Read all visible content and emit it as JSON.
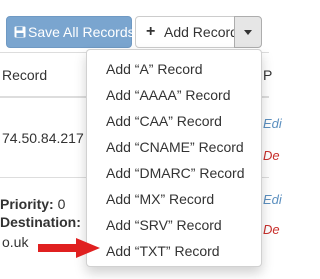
{
  "toolbar": {
    "save_all_label": "Save All Records",
    "add_record_label": "Add Record",
    "save_icon": "floppy-disk-icon",
    "add_icon": "plus-icon",
    "caret_icon": "caret-down-icon"
  },
  "table": {
    "header": {
      "record": "Record",
      "partial_col": "P"
    },
    "row1": {
      "ip": "74.50.84.217",
      "edge_link": "Edi",
      "edge_delete": "De"
    },
    "row2": {
      "priority_label": "Priority:",
      "priority_value": "0",
      "destination_label": "Destination:",
      "destination_value": "o.uk",
      "edge_link": "Edi",
      "edge_delete": "De"
    }
  },
  "menu": {
    "items": [
      "Add “A” Record",
      "Add “AAAA” Record",
      "Add “CAA” Record",
      "Add “CNAME” Record",
      "Add “DMARC” Record",
      "Add “MX” Record",
      "Add “SRV” Record",
      "Add “TXT” Record"
    ]
  },
  "annotation": {
    "arrow_color": "#e02020",
    "arrow_target": "Add “TXT” Record"
  },
  "colors": {
    "primary_button": "#7aa5cf",
    "link": "#5b8fbf",
    "danger": "#c9302c"
  }
}
